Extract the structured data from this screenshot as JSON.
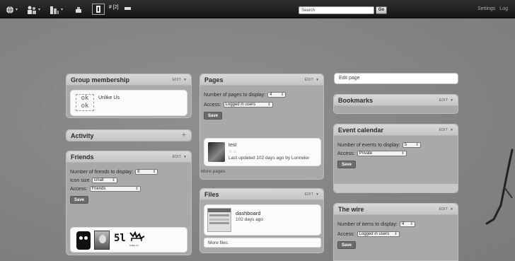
{
  "topbar": {
    "badge": "# [2]",
    "search_placeholder": "Search",
    "go_label": "Go",
    "links": [
      "Settings",
      "Log"
    ],
    "icons": [
      "home-globe-icon",
      "friends-icon",
      "network-icon",
      "messages-icon",
      "notifications-icon",
      "minus-icon"
    ]
  },
  "edit_page": "Edit page",
  "group_membership": {
    "title": "Group membership",
    "edit": "EDIT",
    "group_name": "Unlike Us",
    "group_logo_text": "ok ok"
  },
  "activity": {
    "title": "Activity",
    "add": "+"
  },
  "friends": {
    "title": "Friends",
    "edit": "EDIT",
    "num_label": "Number of friends to display:",
    "num_value": "8",
    "icon_label": "Icon size",
    "icon_value": "small",
    "access_label": "Access:",
    "access_value": "Friends",
    "save": "Save",
    "avatars": [
      "friend-avatar-1",
      "friend-avatar-2",
      "friend-avatar-3",
      "friend-avatar-4"
    ],
    "avatar_texts": [
      "5l",
      "Unlike Us"
    ]
  },
  "pages": {
    "title": "Pages",
    "edit": "EDIT",
    "num_label": "Number of pages to display:",
    "num_value": "4",
    "access_label": "Access:",
    "access_value": "Logged in users",
    "save": "Save",
    "item_title": "test",
    "item_meta": "Last updated 102 days ago by Lonneke",
    "more": "More pages"
  },
  "files": {
    "title": "Files",
    "edit": "EDIT",
    "item_title": "dashboard",
    "item_meta": "102 days ago",
    "more": "More files"
  },
  "bookmarks": {
    "title": "Bookmarks",
    "edit": "EDIT"
  },
  "event_calendar": {
    "title": "Event calendar",
    "edit": "EDIT",
    "num_label": "Number of events to display:",
    "num_value": "5",
    "access_label": "Access:",
    "access_value": "Private",
    "save": "Save"
  },
  "wire": {
    "title": "The wire",
    "edit": "EDIT",
    "num_label": "Number of items to display:",
    "num_value": "4",
    "access_label": "Access:",
    "access_value": "Logged in users",
    "save": "Save"
  }
}
